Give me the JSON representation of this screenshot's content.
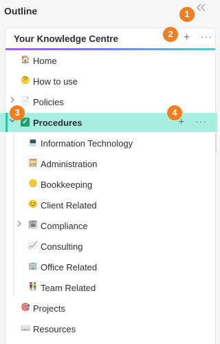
{
  "sidebar": {
    "title": "Outline",
    "collapse_icon": "double-chevron-left-icon"
  },
  "badges": [
    "1",
    "2",
    "3",
    "4"
  ],
  "workspace": {
    "name": "Your Knowledge Centre",
    "add_icon": "+",
    "more_icon": "···"
  },
  "items": [
    {
      "label": "Home",
      "icon": "house-icon",
      "emoji": "🏠"
    },
    {
      "label": "How to use",
      "icon": "thinking-face-icon",
      "emoji": "🤔"
    },
    {
      "label": "Policies",
      "icon": "document-icon",
      "emoji": "📄",
      "expandable": true
    },
    {
      "label": "Procedures",
      "icon": "check-box-icon",
      "active": true,
      "expanded": true
    },
    {
      "label": "Information Technology",
      "icon": "laptop-icon",
      "emoji": "💻"
    },
    {
      "label": "Administration",
      "icon": "abacus-icon",
      "emoji": "🧮"
    },
    {
      "label": "Bookkeeping",
      "icon": "coin-icon",
      "emoji": "🪙"
    },
    {
      "label": "Client Related",
      "icon": "face-icon",
      "emoji": "😊"
    },
    {
      "label": "Compliance",
      "icon": "calendar-icon",
      "emoji": "🗓",
      "expandable": true
    },
    {
      "label": "Consulting",
      "icon": "chart-up-icon",
      "emoji": "📈"
    },
    {
      "label": "Office Related",
      "icon": "office-building-icon",
      "emoji": "🏢"
    },
    {
      "label": "Team Related",
      "icon": "people-icon",
      "emoji": "👫"
    },
    {
      "label": "Projects",
      "icon": "target-icon",
      "emoji": "🎯"
    },
    {
      "label": "Resources",
      "icon": "book-icon",
      "emoji": "📖"
    }
  ],
  "active_controls": {
    "add": "+",
    "more": "···"
  },
  "colors": {
    "accent": "#ef7d22",
    "active_bg": "#a9efe1",
    "check": "#22a06b"
  }
}
